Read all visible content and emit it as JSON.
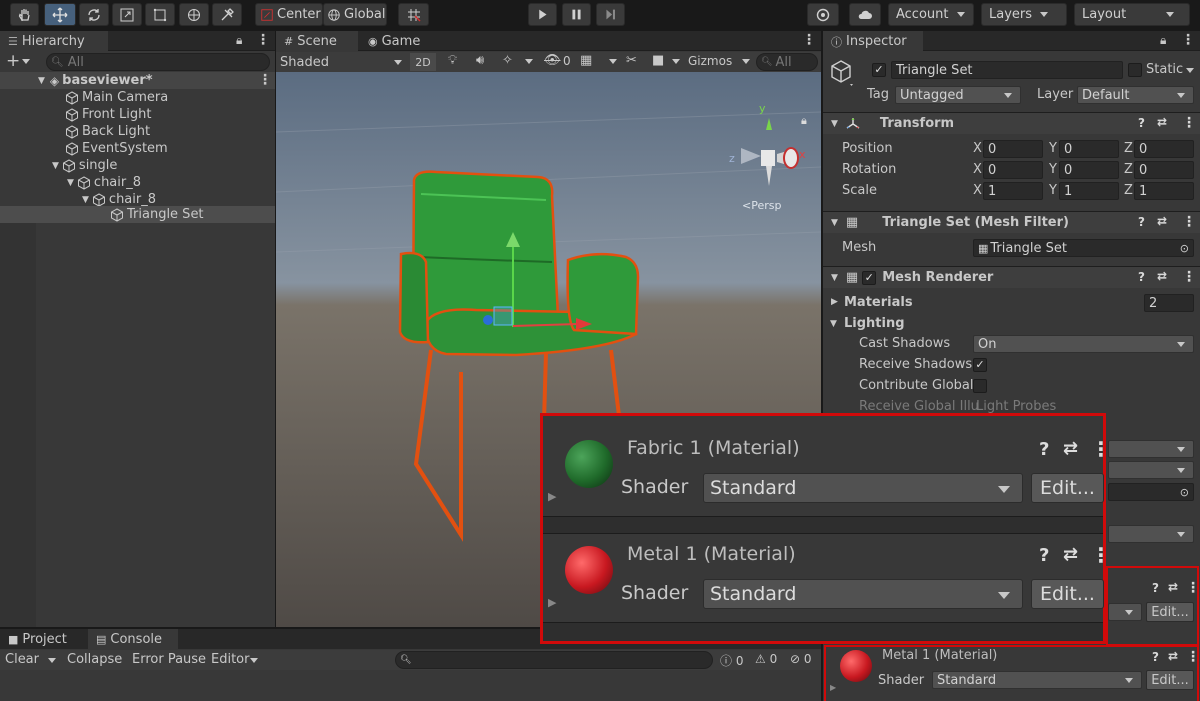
{
  "toolbar": {
    "pivot_label": "Center",
    "space_label": "Global",
    "account_label": "Account",
    "layers_label": "Layers",
    "layout_label": "Layout"
  },
  "hierarchy": {
    "tab_label": "Hierarchy",
    "search_placeholder": "All",
    "scene_name": "baseviewer*",
    "items": [
      {
        "label": "Main Camera"
      },
      {
        "label": "Front Light"
      },
      {
        "label": "Back Light"
      },
      {
        "label": "EventSystem"
      },
      {
        "label": "single"
      },
      {
        "label": "chair_8"
      },
      {
        "label": "chair_8"
      },
      {
        "label": "Triangle Set"
      }
    ]
  },
  "scene": {
    "tabs": [
      {
        "label": "Scene"
      },
      {
        "label": "Game"
      }
    ],
    "shading_mode": "Shaded",
    "mode_2d": "2D",
    "hidden_count": "0",
    "gizmos_label": "Gizmos",
    "search_placeholder": "All",
    "persp_label": "<Persp"
  },
  "inspector": {
    "tab_label": "Inspector",
    "object_name": "Triangle Set",
    "static_label": "Static",
    "tag_label": "Tag",
    "tag_value": "Untagged",
    "layer_label": "Layer",
    "layer_value": "Default",
    "transform": {
      "title": "Transform",
      "position_label": "Position",
      "rotation_label": "Rotation",
      "scale_label": "Scale",
      "x": "X",
      "y": "Y",
      "z": "Z",
      "position": [
        "0",
        "0",
        "0"
      ],
      "rotation": [
        "0",
        "0",
        "0"
      ],
      "scale": [
        "1",
        "1",
        "1"
      ]
    },
    "mesh_filter": {
      "title": "Triangle Set (Mesh Filter)",
      "mesh_label": "Mesh",
      "mesh_value": "Triangle Set"
    },
    "mesh_renderer": {
      "title": "Mesh Renderer",
      "materials_label": "Materials",
      "materials_count": "2",
      "lighting_label": "Lighting",
      "cast_shadows_label": "Cast Shadows",
      "cast_shadows_value": "On",
      "receive_shadows_label": "Receive Shadows",
      "contribute_global_label": "Contribute Global",
      "receive_gi_label": "Receive Global Illu",
      "receive_gi_value": "Light Probes"
    },
    "small_material": {
      "title": "Metal 1 (Material)",
      "shader_label": "Shader",
      "shader_value": "Standard",
      "edit_label": "Edit..."
    },
    "partial_edit_label": "Edit..."
  },
  "zoom": {
    "materials": [
      {
        "title": "Fabric 1 (Material)",
        "shader_label": "Shader",
        "shader_value": "Standard",
        "edit_label": "Edit...",
        "color": "#1f6a2a"
      },
      {
        "title": "Metal 1 (Material)",
        "shader_label": "Shader",
        "shader_value": "Standard",
        "edit_label": "Edit...",
        "color": "#c81820"
      }
    ]
  },
  "bottom": {
    "tabs": [
      {
        "label": "Project"
      },
      {
        "label": "Console"
      }
    ],
    "clear_label": "Clear",
    "collapse_label": "Collapse",
    "error_pause_label": "Error Pause",
    "editor_label": "Editor",
    "counts": {
      "info": "0",
      "warn": "0",
      "error": "0"
    }
  },
  "colors": {
    "highlight_red": "#d10a0a",
    "selection_blue": "#46607c",
    "chair_green": "#2f9a3a",
    "chair_legs": "#e04a10"
  }
}
